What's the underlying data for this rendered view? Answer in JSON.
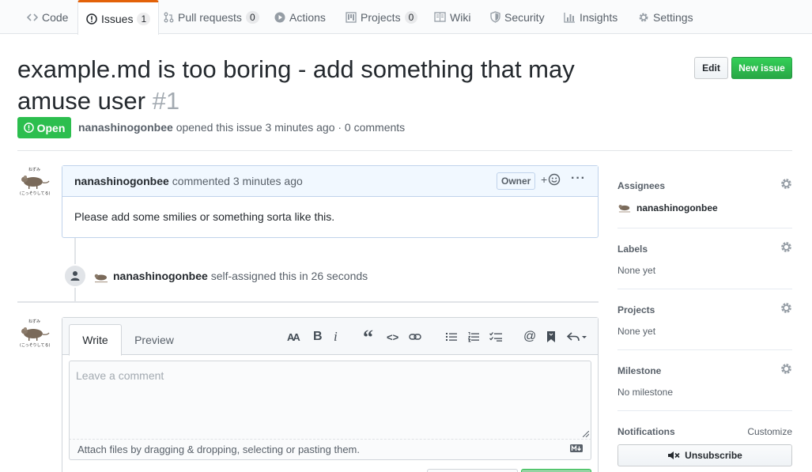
{
  "tabs": [
    {
      "label": "Code",
      "icon": "code-icon"
    },
    {
      "label": "Issues",
      "count": "1",
      "icon": "issue-opened-icon",
      "selected": true
    },
    {
      "label": "Pull requests",
      "count": "0",
      "icon": "git-pull-request-icon"
    },
    {
      "label": "Actions",
      "icon": "play-icon"
    },
    {
      "label": "Projects",
      "count": "0",
      "icon": "project-icon"
    },
    {
      "label": "Wiki",
      "icon": "book-icon"
    },
    {
      "label": "Security",
      "icon": "shield-icon"
    },
    {
      "label": "Insights",
      "icon": "graph-icon"
    },
    {
      "label": "Settings",
      "icon": "gear-icon"
    }
  ],
  "issue": {
    "title": "example.md is too boring - add something that may amuse user",
    "number": "#1",
    "state": "Open",
    "author": "nanashinogonbee",
    "meta_text": "opened this issue 3 minutes ago · 0 comments"
  },
  "header_buttons": {
    "edit": "Edit",
    "new_issue": "New issue"
  },
  "comment": {
    "author": "nanashinogonbee",
    "time_text": "commented 3 minutes ago",
    "owner_label": "Owner",
    "reaction": "+",
    "more": "···",
    "body": "Please add some smilies or something sorta like this."
  },
  "event": {
    "author": "nanashinogonbee",
    "text": "self-assigned this in 26 seconds"
  },
  "avatar_caption": {
    "top": "ねずみ",
    "bottom": "(こっそりしてる)"
  },
  "form": {
    "write_tab": "Write",
    "preview_tab": "Preview",
    "placeholder": "Leave a comment",
    "attach_text": "Attach files by dragging & dropping, selecting or pasting them.",
    "toolbar": {
      "heading": "AA",
      "bold": "B",
      "italic": "i",
      "quote": "“",
      "code": "<>",
      "mention": "@"
    }
  },
  "sidebar": {
    "assignees": {
      "heading": "Assignees",
      "user": "nanashinogonbee"
    },
    "labels": {
      "heading": "Labels",
      "value": "None yet"
    },
    "projects": {
      "heading": "Projects",
      "value": "None yet"
    },
    "milestone": {
      "heading": "Milestone",
      "value": "No milestone"
    },
    "notifications": {
      "heading": "Notifications",
      "customize": "Customize",
      "unsubscribe": "Unsubscribe"
    }
  },
  "colors": {
    "open_green": "#2cbe4e",
    "tab_accent": "#e36209",
    "comment_header_bg": "#f1f8ff"
  }
}
